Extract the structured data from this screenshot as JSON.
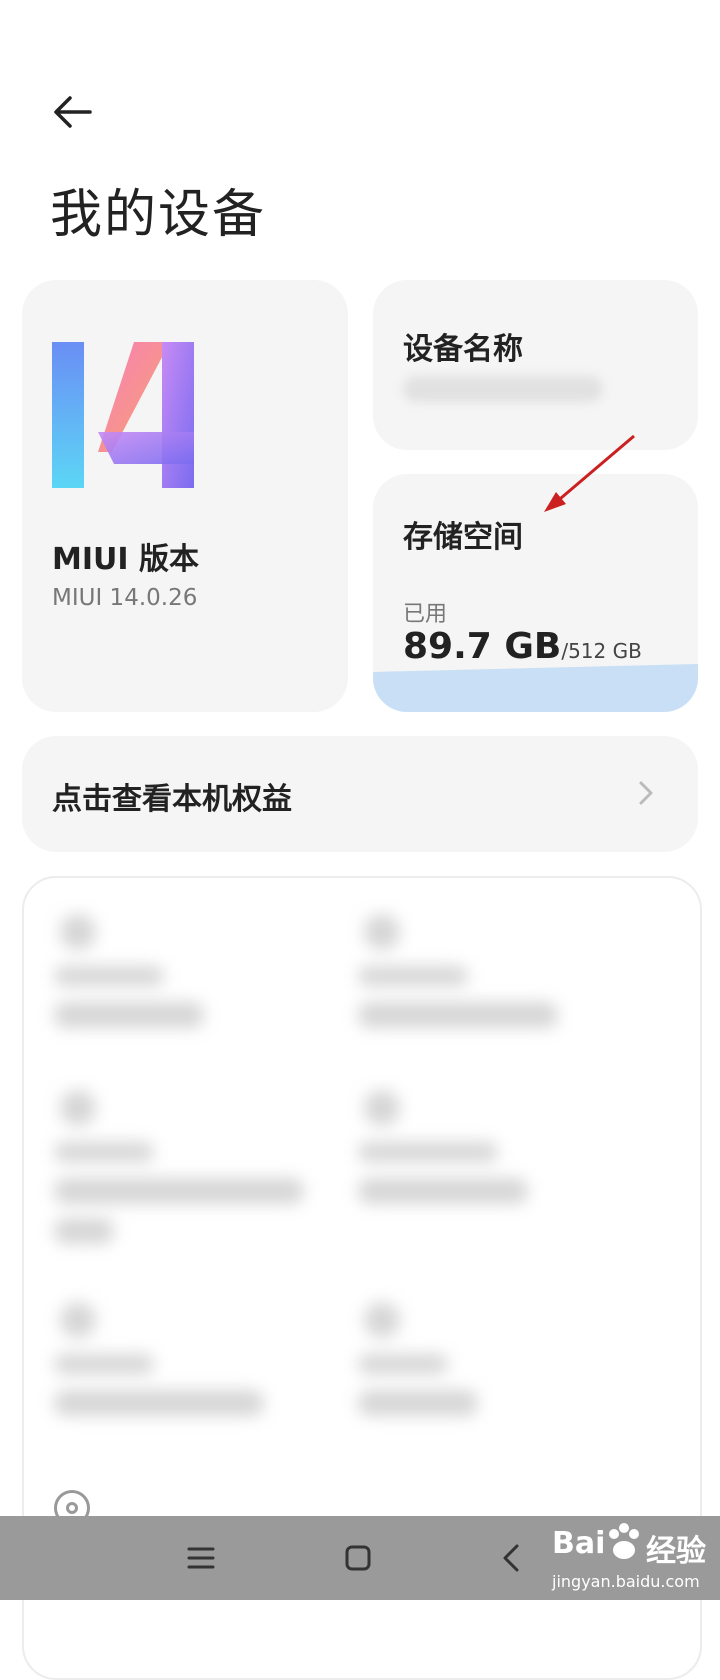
{
  "page": {
    "title": "我的设备"
  },
  "miui": {
    "label": "MIUI 版本",
    "version": "MIUI 14.0.26"
  },
  "device_name": {
    "label": "设备名称"
  },
  "storage": {
    "label": "存储空间",
    "used_label": "已用",
    "used_value": "89.7 GB",
    "total_value": "/512 GB",
    "used_fraction": 0.175
  },
  "benefits": {
    "label": "点击查看本机权益"
  },
  "navbar": {
    "items": [
      "menu-icon",
      "home-icon",
      "back-icon"
    ]
  },
  "watermark": {
    "brand": "Bai",
    "brand_cn": "经验",
    "url": "jingyan.baidu.com"
  },
  "colors": {
    "storage_fill": "#c9dff5",
    "annotation_arrow": "#cc1f1f"
  }
}
